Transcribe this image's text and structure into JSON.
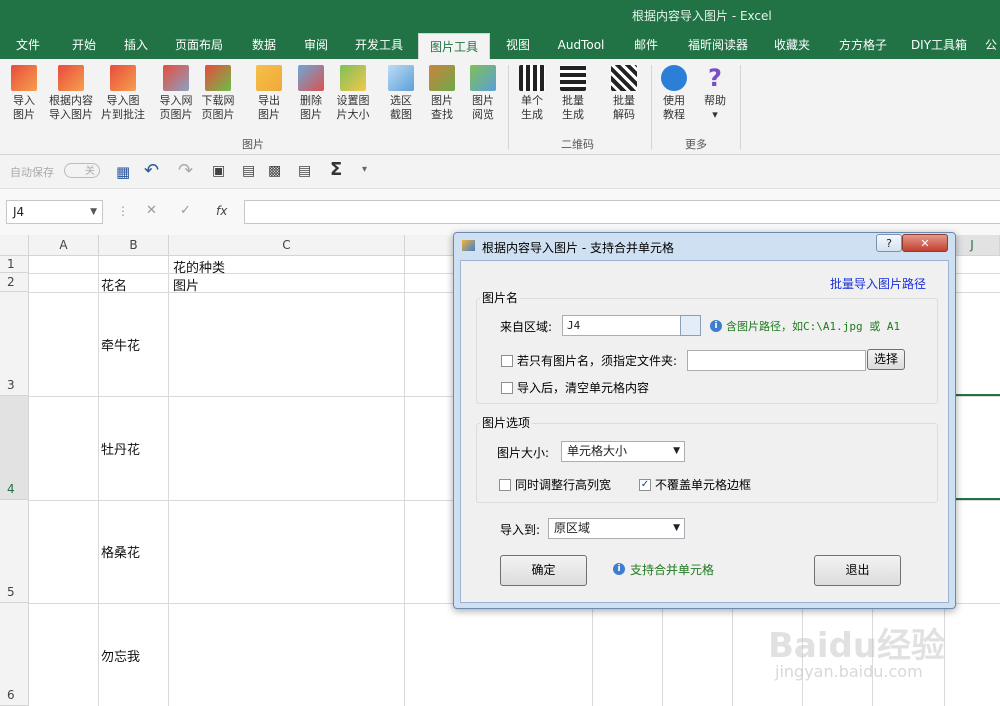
{
  "window": {
    "title": "根据内容导入图片  -  Excel"
  },
  "tabs": [
    "文件",
    "开始",
    "插入",
    "页面布局",
    "数据",
    "审阅",
    "开发工具",
    "图片工具",
    "视图",
    "AudTool",
    "邮件",
    "福昕阅读器",
    "收藏夹",
    "方方格子",
    "DIY工具箱",
    "公"
  ],
  "ribbon": {
    "buttons": [
      {
        "label1": "导入",
        "label2": "图片"
      },
      {
        "label1": "根据内容",
        "label2": "导入图片"
      },
      {
        "label1": "导入图",
        "label2": "片到批注"
      },
      {
        "label1": "导入网",
        "label2": "页图片"
      },
      {
        "label1": "下载网",
        "label2": "页图片"
      },
      {
        "label1": "导出",
        "label2": "图片"
      },
      {
        "label1": "删除",
        "label2": "图片"
      },
      {
        "label1": "设置图",
        "label2": "片大小"
      },
      {
        "label1": "选区",
        "label2": "截图"
      },
      {
        "label1": "图片",
        "label2": "查找"
      },
      {
        "label1": "图片",
        "label2": "阅览"
      },
      {
        "label1": "单个",
        "label2": "生成"
      },
      {
        "label1": "批量",
        "label2": "生成"
      },
      {
        "label1": "批量",
        "label2": "解码"
      },
      {
        "label1": "使用",
        "label2": "教程"
      },
      {
        "label1": "帮助",
        "label2": "▾"
      }
    ],
    "groups": [
      "图片",
      "二维码",
      "更多"
    ]
  },
  "qat": {
    "autosave_label": "自动保存",
    "autosave_state": "关"
  },
  "formula": {
    "namebox": "J4",
    "fx": "fx"
  },
  "grid": {
    "columns": [
      "A",
      "B",
      "C",
      "J"
    ],
    "rows": [
      "1",
      "2",
      "3",
      "4",
      "5",
      "6"
    ],
    "cells": {
      "c1": "花的种类",
      "b2": "花名",
      "c2": "图片",
      "b3": "牵牛花",
      "b4": "牡丹花",
      "b5": "格桑花",
      "b6": "勿忘我"
    }
  },
  "dialog": {
    "title": "根据内容导入图片 - 支持合并单元格",
    "help_btn": "?",
    "close_btn": "✕",
    "batch_link": "批量导入图片路径",
    "group1_label": "图片名",
    "source_label": "来自区域:",
    "source_value": "J4",
    "source_hint": "含图片路径，如C:\\A1.jpg 或 A1",
    "only_name_label": "若只有图片名，须指定文件夹:",
    "choose_btn": "选择",
    "clear_label": "导入后，清空单元格内容",
    "group2_label": "图片选项",
    "size_label": "图片大小:",
    "size_value": "单元格大小",
    "adjust_label": "同时调整行高列宽",
    "keep_border_label": "不覆盖单元格边框",
    "import_to_label": "导入到:",
    "import_to_value": "原区域",
    "ok_btn": "确定",
    "merge_hint": "支持合并单元格",
    "exit_btn": "退出"
  },
  "watermark": {
    "brand": "Baidu经验",
    "url": "jingyan.baidu.com"
  }
}
